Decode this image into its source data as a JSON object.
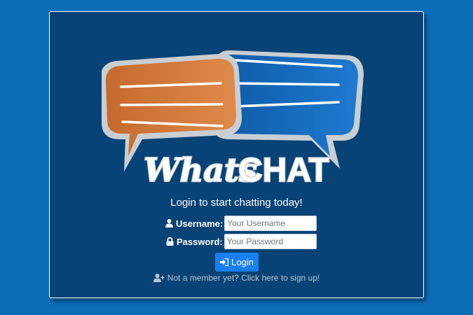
{
  "logo": {
    "word_1": "Whats",
    "word_2": "CHAT"
  },
  "form": {
    "tagline": "Login to start chatting today!",
    "username_label": "Username:",
    "username_placeholder": "Your Username",
    "password_label": "Password:",
    "password_placeholder": "Your Password",
    "login_label": "Login",
    "signup_text": "Not a member yet? Click here to sign up!"
  },
  "colors": {
    "page_background": "#0a6db8",
    "panel_background": "#074377",
    "orange_bubble": "#d0793a",
    "blue_bubble": "#1770c4",
    "login_button": "#1a7ff0"
  },
  "icons": {
    "username": "user-icon",
    "password": "lock-icon",
    "login": "sign-in-icon",
    "signup": "user-plus-icon"
  }
}
